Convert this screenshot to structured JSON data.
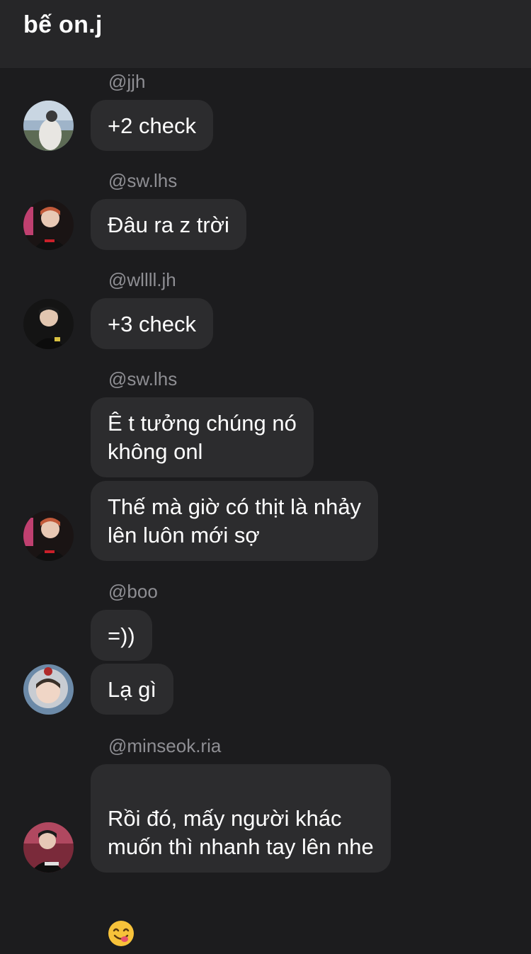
{
  "header": {
    "title": "bế on.j"
  },
  "messages": [
    {
      "username": "@jjh",
      "bubbles": [
        "+2 check"
      ]
    },
    {
      "username": "@sw.lhs",
      "bubbles": [
        "Đâu ra z trời"
      ]
    },
    {
      "username": "@wllll.jh",
      "bubbles": [
        "+3 check"
      ]
    },
    {
      "username": "@sw.lhs",
      "bubbles": [
        "Ê t tưởng chúng nó\nkhông onl",
        "Thế mà giờ có thịt là nhảy\nlên luôn mới sợ"
      ]
    },
    {
      "username": "@boo",
      "bubbles": [
        "=))",
        "Lạ gì"
      ]
    },
    {
      "username": "@minseok.ria",
      "bubbles": [
        "Rồi đó, mấy người khác\nmuốn thì nhanh tay lên nhe"
      ],
      "emoji": "face-savoring-food-emoji"
    }
  ],
  "avatars": [
    "avatar-jjh",
    "avatar-sw-lhs",
    "avatar-wllll-jh",
    "avatar-sw-lhs",
    "avatar-boo",
    "avatar-minseok-ria"
  ]
}
